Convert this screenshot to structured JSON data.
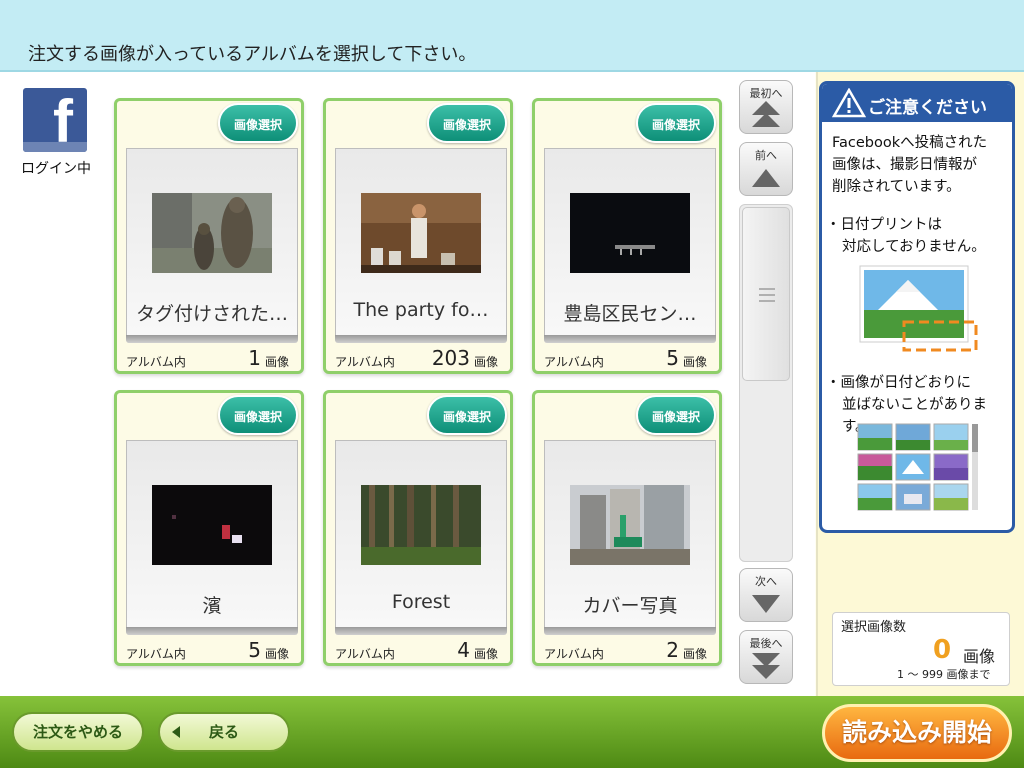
{
  "header": {
    "instruction": "注文する画像が入っているアルバムを選択して下さい。"
  },
  "account": {
    "status": "ログイン中",
    "service_icon": "facebook-icon"
  },
  "albums": [
    {
      "name": "タグ付けされた…",
      "location_label": "アルバム内",
      "count": "1",
      "unit": "画像",
      "select_label": "画像選択"
    },
    {
      "name": "The party fo…",
      "location_label": "アルバム内",
      "count": "203",
      "unit": "画像",
      "select_label": "画像選択"
    },
    {
      "name": "豊島区民セン…",
      "location_label": "アルバム内",
      "count": "5",
      "unit": "画像",
      "select_label": "画像選択"
    },
    {
      "name": "濱",
      "location_label": "アルバム内",
      "count": "5",
      "unit": "画像",
      "select_label": "画像選択"
    },
    {
      "name": "Forest",
      "location_label": "アルバム内",
      "count": "4",
      "unit": "画像",
      "select_label": "画像選択"
    },
    {
      "name": "カバー写真",
      "location_label": "アルバム内",
      "count": "2",
      "unit": "画像",
      "select_label": "画像選択"
    }
  ],
  "scroll": {
    "first": "最初へ",
    "prev": "前へ",
    "next": "次へ",
    "last": "最後へ"
  },
  "notice": {
    "title": "ご注意ください",
    "line1": "Facebookへ投稿された",
    "line2": "画像は、撮影日情報が",
    "line3": "削除されています。",
    "bullet1_line1": "・日付プリントは",
    "bullet1_line2": "対応しておりません。",
    "bullet2_line1": "・画像が日付どおりに",
    "bullet2_line2": "並ばないことがあります。"
  },
  "selected": {
    "label": "選択画像数",
    "count": "0",
    "unit": "画像",
    "range": "1 ～ 999 画像まで"
  },
  "footer": {
    "cancel_order": "注文をやめる",
    "back": "戻る",
    "start": "読み込み開始"
  },
  "colors": {
    "accent_teal": "#17a08a",
    "footer_green": "#6fae2a",
    "notice_blue": "#2b5ba6",
    "start_orange": "#f08a20"
  }
}
